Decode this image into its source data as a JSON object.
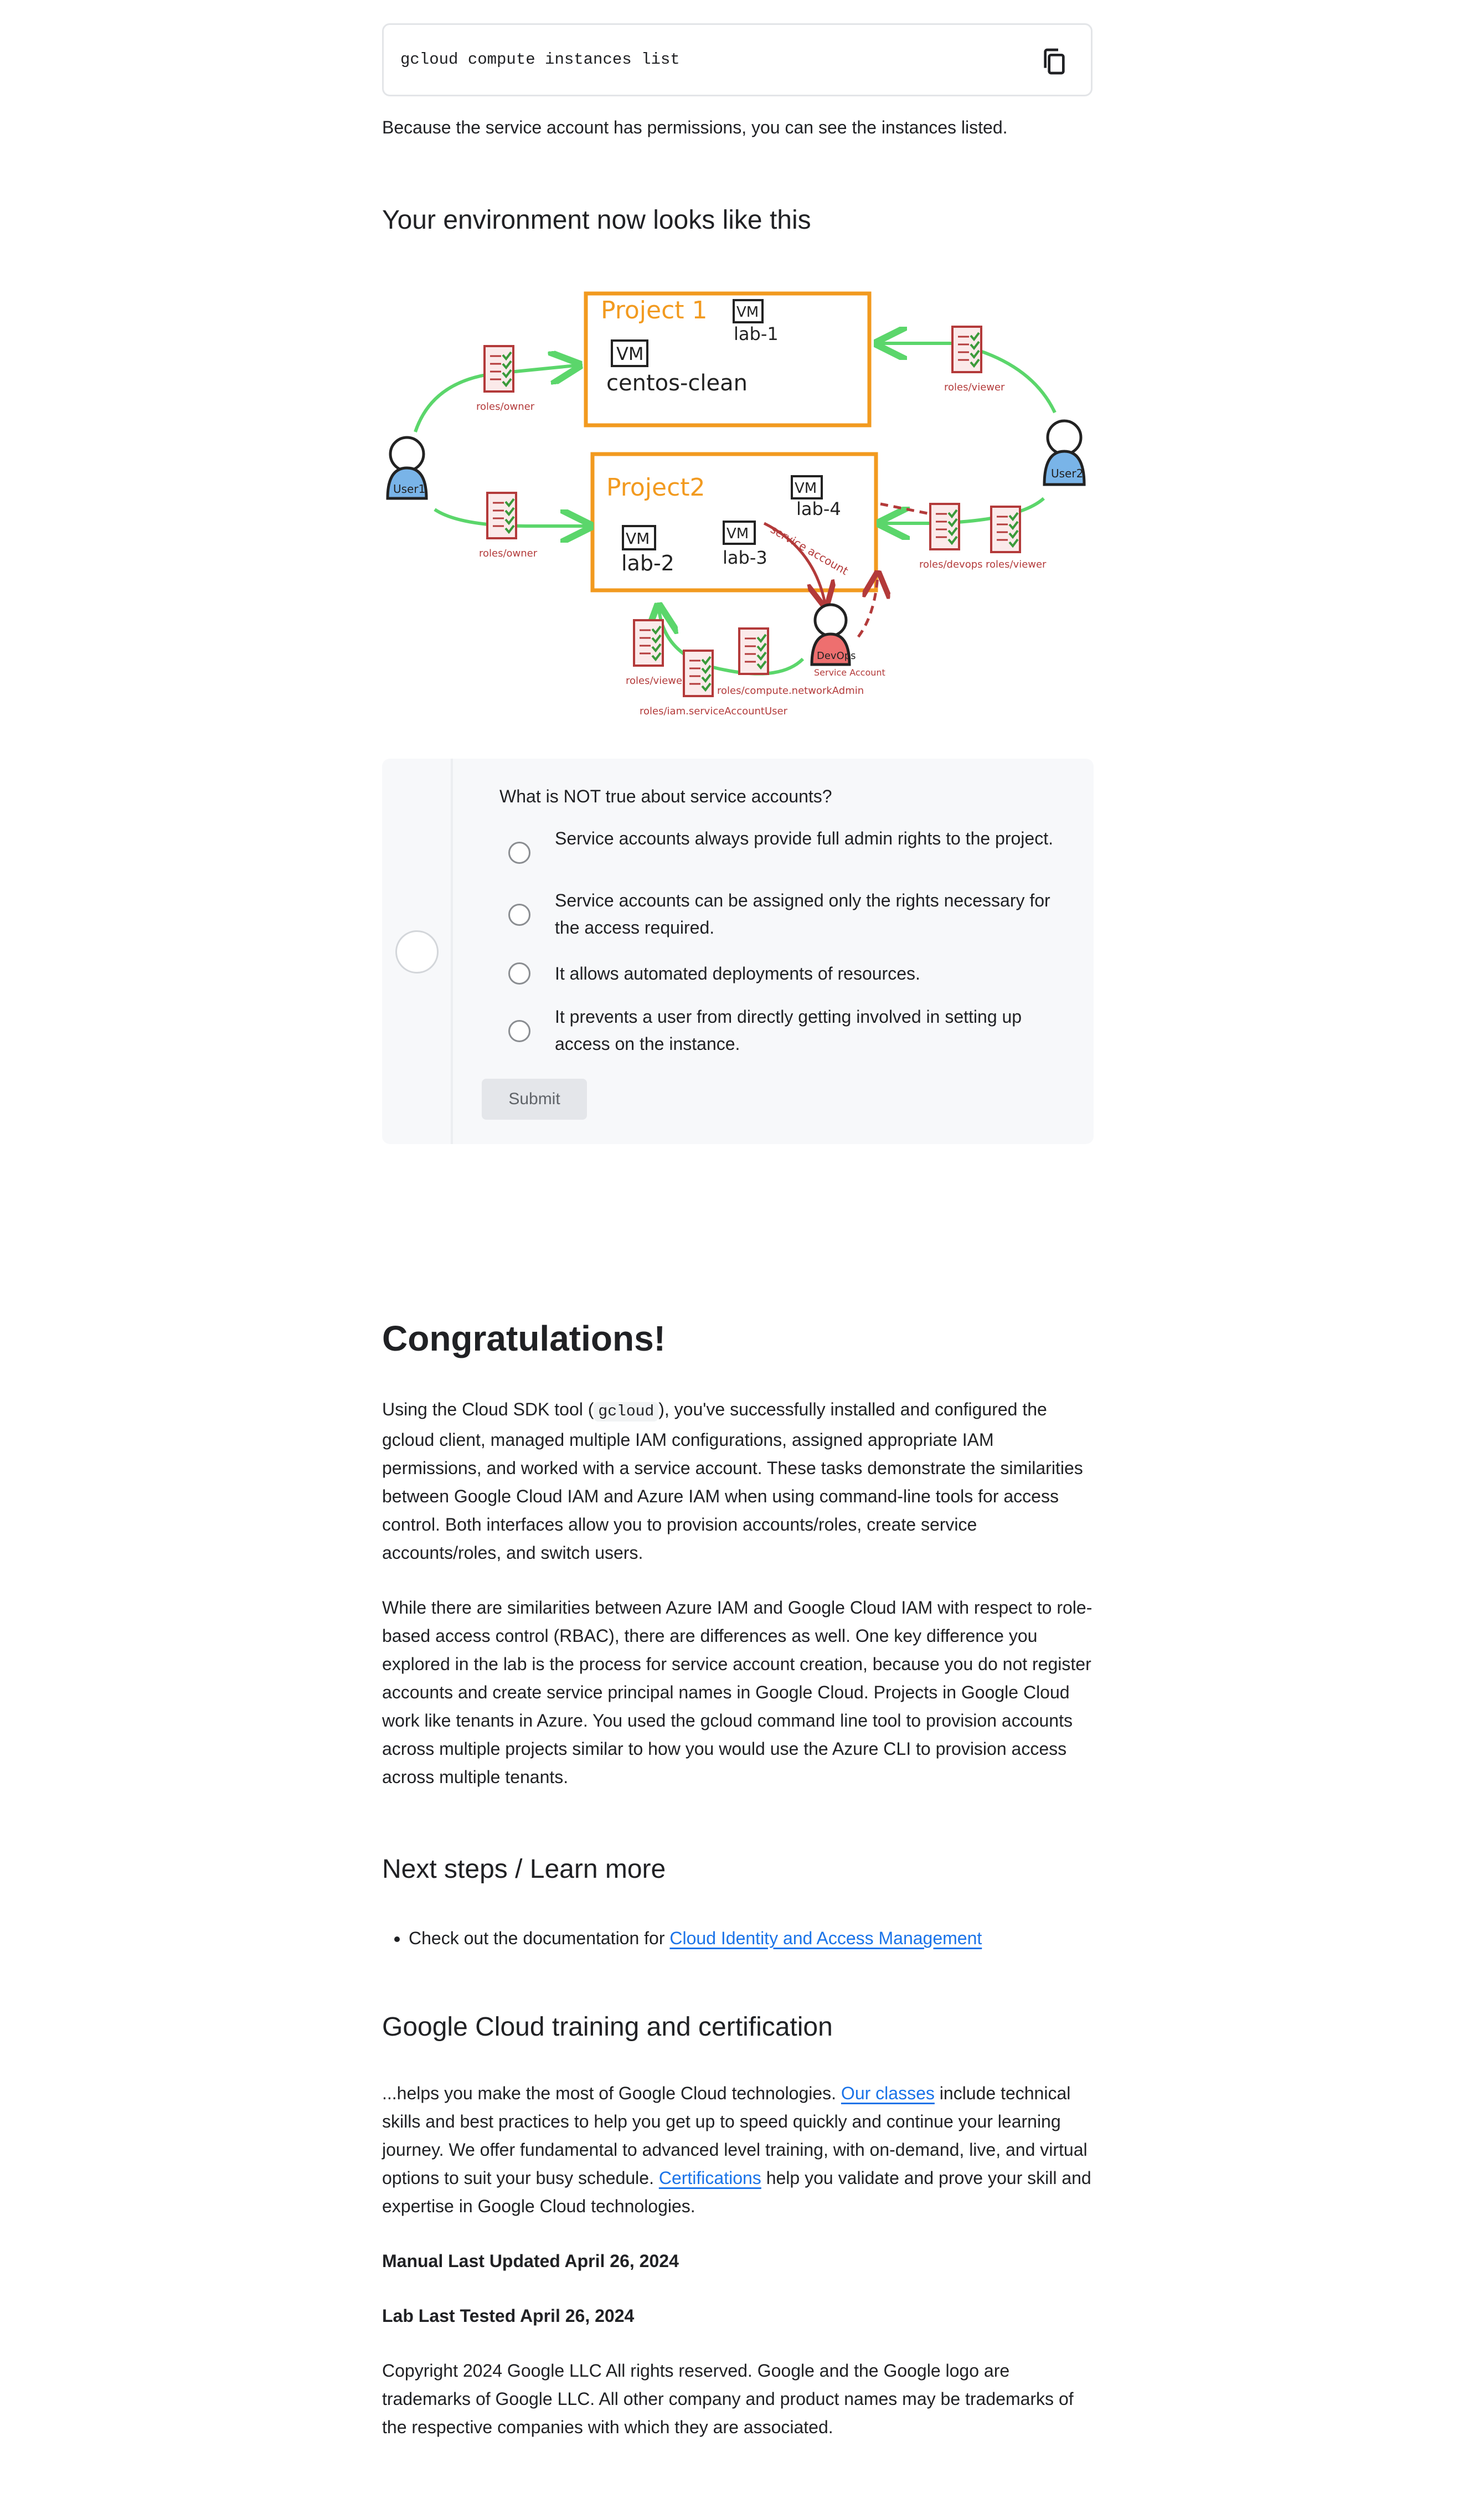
{
  "code_block": {
    "command": "gcloud compute instances list",
    "copy_icon": "copy-icon"
  },
  "intro_text": "Because the service account has permissions, you can see the instances listed.",
  "env_heading": "Your environment now looks like this",
  "diagram": {
    "project1": "Project 1",
    "project2": "Project2",
    "vm": "VM",
    "lab1": "lab-1",
    "lab2": "lab-2",
    "lab3": "lab-3",
    "lab4": "lab-4",
    "centos": "centos-clean",
    "user1": "User1",
    "user2": "User2",
    "devops": "DevOps",
    "roles_owner": "roles/owner",
    "roles_viewer": "roles/viewer",
    "roles_devops": "roles/devops",
    "roles_compute_admin": "roles/compute.networkAdmin",
    "roles_sa_user": "roles/iam.serviceAccountUser",
    "service_account": "Service Account",
    "service_account_arc": "service account"
  },
  "quiz": {
    "question": "What is NOT true about service accounts?",
    "options": [
      "Service accounts always provide full admin rights to the project.",
      "Service accounts can be assigned only the rights necessary for the access required.",
      "It allows automated deployments of resources.",
      "It prevents a user from directly getting involved in setting up access on the instance."
    ],
    "submit_label": "Submit"
  },
  "congrats": {
    "heading": "Congratulations!",
    "para1_pre": "Using the Cloud SDK tool (",
    "para1_code": "gcloud",
    "para1_post": "), you've successfully installed and configured the gcloud client, managed multiple IAM configurations, assigned appropriate IAM permissions, and worked with a service account. These tasks demonstrate the similarities between Google Cloud IAM and Azure IAM when using command-line tools for access control. Both interfaces allow you to provision accounts/roles, create service accounts/roles, and switch users.",
    "para2": "While there are similarities between Azure IAM and Google Cloud IAM with respect to role-based access control (RBAC), there are differences as well. One key difference you explored in the lab is the process for service account creation, because you do not register accounts and create service principal names in Google Cloud. Projects in Google Cloud work like tenants in Azure. You used the gcloud command line tool to provision accounts across multiple projects similar to how you would use the Azure CLI to provision access across multiple tenants."
  },
  "next_steps": {
    "heading": "Next steps / Learn more",
    "item_pre": "Check out the documentation for ",
    "item_link": "Cloud Identity and Access Management"
  },
  "training": {
    "heading": "Google Cloud training and certification",
    "pre": "...helps you make the most of Google Cloud technologies. ",
    "link1": "Our classes",
    "mid": " include technical skills and best practices to help you get up to speed quickly and continue your learning journey. We offer fundamental to advanced level training, with on-demand, live, and virtual options to suit your busy schedule. ",
    "link2": "Certifications",
    "post": " help you validate and prove your skill and expertise in Google Cloud technologies."
  },
  "manual_updated": "Manual Last Updated April 26, 2024",
  "lab_tested": "Lab Last Tested April 26, 2024",
  "copyright": "Copyright 2024 Google LLC All rights reserved. Google and the Google logo are trademarks of Google LLC. All other company and product names may be trademarks of the respective companies with which they are associated.",
  "colors": {
    "accent": "#1a73e8",
    "project_box": "#f29a1f",
    "arrow_green": "#5bd66b",
    "arrow_red": "#b33a3a",
    "user_blue": "#79b4e8",
    "devops_red": "#ee6f6f"
  }
}
